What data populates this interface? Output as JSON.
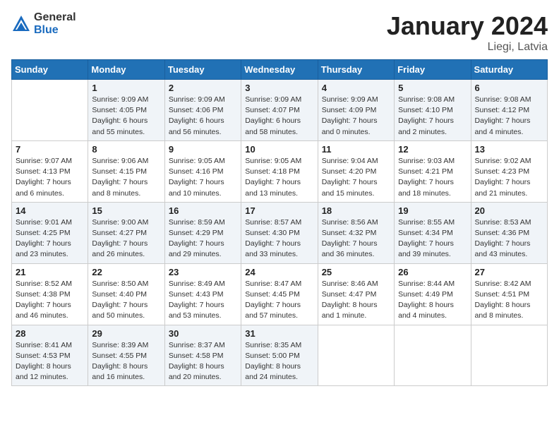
{
  "header": {
    "logo_general": "General",
    "logo_blue": "Blue",
    "title": "January 2024",
    "subtitle": "Liegi, Latvia"
  },
  "days_of_week": [
    "Sunday",
    "Monday",
    "Tuesday",
    "Wednesday",
    "Thursday",
    "Friday",
    "Saturday"
  ],
  "weeks": [
    [
      {
        "day": "",
        "info": ""
      },
      {
        "day": "1",
        "info": "Sunrise: 9:09 AM\nSunset: 4:05 PM\nDaylight: 6 hours\nand 55 minutes."
      },
      {
        "day": "2",
        "info": "Sunrise: 9:09 AM\nSunset: 4:06 PM\nDaylight: 6 hours\nand 56 minutes."
      },
      {
        "day": "3",
        "info": "Sunrise: 9:09 AM\nSunset: 4:07 PM\nDaylight: 6 hours\nand 58 minutes."
      },
      {
        "day": "4",
        "info": "Sunrise: 9:09 AM\nSunset: 4:09 PM\nDaylight: 7 hours\nand 0 minutes."
      },
      {
        "day": "5",
        "info": "Sunrise: 9:08 AM\nSunset: 4:10 PM\nDaylight: 7 hours\nand 2 minutes."
      },
      {
        "day": "6",
        "info": "Sunrise: 9:08 AM\nSunset: 4:12 PM\nDaylight: 7 hours\nand 4 minutes."
      }
    ],
    [
      {
        "day": "7",
        "info": "Sunrise: 9:07 AM\nSunset: 4:13 PM\nDaylight: 7 hours\nand 6 minutes."
      },
      {
        "day": "8",
        "info": "Sunrise: 9:06 AM\nSunset: 4:15 PM\nDaylight: 7 hours\nand 8 minutes."
      },
      {
        "day": "9",
        "info": "Sunrise: 9:05 AM\nSunset: 4:16 PM\nDaylight: 7 hours\nand 10 minutes."
      },
      {
        "day": "10",
        "info": "Sunrise: 9:05 AM\nSunset: 4:18 PM\nDaylight: 7 hours\nand 13 minutes."
      },
      {
        "day": "11",
        "info": "Sunrise: 9:04 AM\nSunset: 4:20 PM\nDaylight: 7 hours\nand 15 minutes."
      },
      {
        "day": "12",
        "info": "Sunrise: 9:03 AM\nSunset: 4:21 PM\nDaylight: 7 hours\nand 18 minutes."
      },
      {
        "day": "13",
        "info": "Sunrise: 9:02 AM\nSunset: 4:23 PM\nDaylight: 7 hours\nand 21 minutes."
      }
    ],
    [
      {
        "day": "14",
        "info": "Sunrise: 9:01 AM\nSunset: 4:25 PM\nDaylight: 7 hours\nand 23 minutes."
      },
      {
        "day": "15",
        "info": "Sunrise: 9:00 AM\nSunset: 4:27 PM\nDaylight: 7 hours\nand 26 minutes."
      },
      {
        "day": "16",
        "info": "Sunrise: 8:59 AM\nSunset: 4:29 PM\nDaylight: 7 hours\nand 29 minutes."
      },
      {
        "day": "17",
        "info": "Sunrise: 8:57 AM\nSunset: 4:30 PM\nDaylight: 7 hours\nand 33 minutes."
      },
      {
        "day": "18",
        "info": "Sunrise: 8:56 AM\nSunset: 4:32 PM\nDaylight: 7 hours\nand 36 minutes."
      },
      {
        "day": "19",
        "info": "Sunrise: 8:55 AM\nSunset: 4:34 PM\nDaylight: 7 hours\nand 39 minutes."
      },
      {
        "day": "20",
        "info": "Sunrise: 8:53 AM\nSunset: 4:36 PM\nDaylight: 7 hours\nand 43 minutes."
      }
    ],
    [
      {
        "day": "21",
        "info": "Sunrise: 8:52 AM\nSunset: 4:38 PM\nDaylight: 7 hours\nand 46 minutes."
      },
      {
        "day": "22",
        "info": "Sunrise: 8:50 AM\nSunset: 4:40 PM\nDaylight: 7 hours\nand 50 minutes."
      },
      {
        "day": "23",
        "info": "Sunrise: 8:49 AM\nSunset: 4:43 PM\nDaylight: 7 hours\nand 53 minutes."
      },
      {
        "day": "24",
        "info": "Sunrise: 8:47 AM\nSunset: 4:45 PM\nDaylight: 7 hours\nand 57 minutes."
      },
      {
        "day": "25",
        "info": "Sunrise: 8:46 AM\nSunset: 4:47 PM\nDaylight: 8 hours\nand 1 minute."
      },
      {
        "day": "26",
        "info": "Sunrise: 8:44 AM\nSunset: 4:49 PM\nDaylight: 8 hours\nand 4 minutes."
      },
      {
        "day": "27",
        "info": "Sunrise: 8:42 AM\nSunset: 4:51 PM\nDaylight: 8 hours\nand 8 minutes."
      }
    ],
    [
      {
        "day": "28",
        "info": "Sunrise: 8:41 AM\nSunset: 4:53 PM\nDaylight: 8 hours\nand 12 minutes."
      },
      {
        "day": "29",
        "info": "Sunrise: 8:39 AM\nSunset: 4:55 PM\nDaylight: 8 hours\nand 16 minutes."
      },
      {
        "day": "30",
        "info": "Sunrise: 8:37 AM\nSunset: 4:58 PM\nDaylight: 8 hours\nand 20 minutes."
      },
      {
        "day": "31",
        "info": "Sunrise: 8:35 AM\nSunset: 5:00 PM\nDaylight: 8 hours\nand 24 minutes."
      },
      {
        "day": "",
        "info": ""
      },
      {
        "day": "",
        "info": ""
      },
      {
        "day": "",
        "info": ""
      }
    ]
  ]
}
